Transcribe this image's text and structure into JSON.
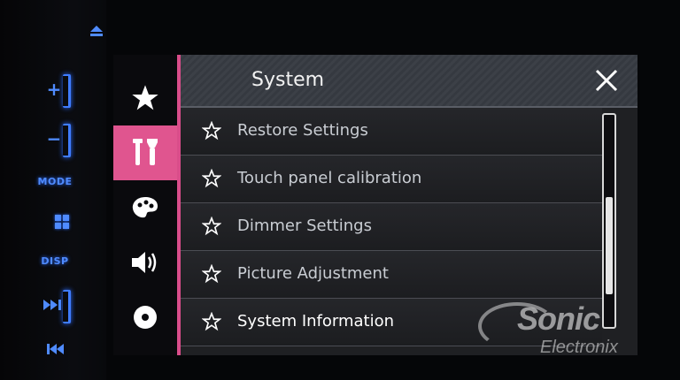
{
  "hardware": {
    "mode_label": "MODE",
    "disp_label": "DISP",
    "accent_color": "#3f7cff"
  },
  "sidebar": {
    "tabs": [
      {
        "icon": "star-icon",
        "active": false
      },
      {
        "icon": "tools-icon",
        "active": true
      },
      {
        "icon": "palette-icon",
        "active": false
      },
      {
        "icon": "speaker-icon",
        "active": false
      },
      {
        "icon": "disc-icon",
        "active": false
      }
    ],
    "active_color": "#e0558f"
  },
  "header": {
    "title": "System"
  },
  "menu": {
    "items": [
      {
        "label": "Restore Settings"
      },
      {
        "label": "Touch panel calibration"
      },
      {
        "label": "Dimmer Settings"
      },
      {
        "label": "Picture Adjustment"
      },
      {
        "label": "System Information"
      }
    ]
  },
  "scrollbar": {
    "position": 0.72
  },
  "watermark": {
    "brand": "Sonic",
    "sub": "Electronix"
  }
}
